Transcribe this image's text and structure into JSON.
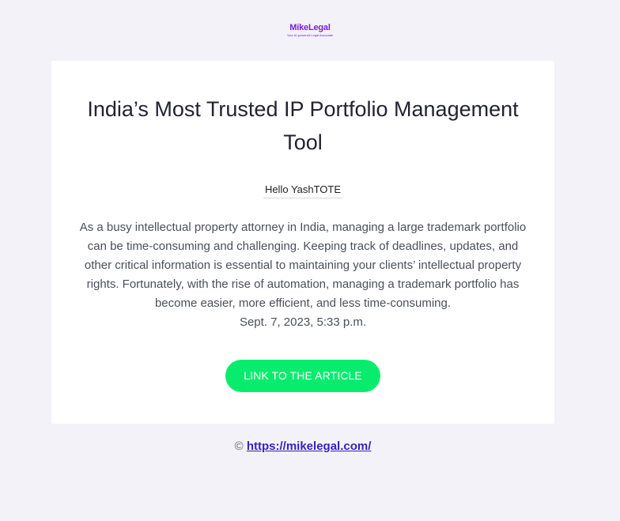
{
  "brand": {
    "name": "MikeLegal",
    "tagline": "Your AI-powered Legal Associate",
    "color": "#7a1fd6"
  },
  "email": {
    "title": "India’s Most Trusted IP Portfolio Management Tool",
    "greeting": "Hello YashTOTE",
    "body": "As a busy intellectual property attorney in India, managing a large trademark portfolio can be time-consuming and challenging. Keeping track of deadlines, updates, and other critical information is essential to maintaining your clients’ intellectual property rights. Fortunately, with the rise of automation, managing a trademark portfolio has become easier, more efficient, and less time-consuming.",
    "date": "Sept. 7, 2023, 5:33 p.m.",
    "cta_label": "LINK TO THE ARTICLE",
    "cta_color": "#08ec6e"
  },
  "footer": {
    "copyright_symbol": "©",
    "link_text": "https://mikelegal.com/"
  }
}
